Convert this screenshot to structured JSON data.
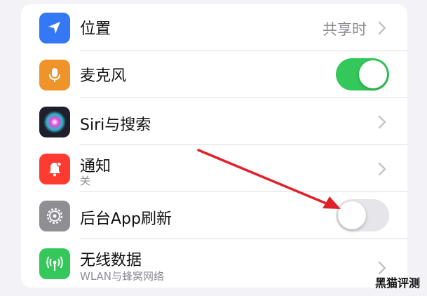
{
  "rows": [
    {
      "title": "位置",
      "value": "共享时",
      "icon": "location-arrow-icon",
      "color": "#3478f6"
    },
    {
      "title": "麦克风",
      "toggle_on": true,
      "icon": "microphone-icon",
      "color": "#f0932b"
    },
    {
      "title": "Siri与搜索",
      "icon": "siri-icon",
      "color": "#2b2b3a"
    },
    {
      "title": "通知",
      "subtitle": "关",
      "icon": "bell-icon",
      "color": "#ff3b30"
    },
    {
      "title": "后台App刷新",
      "toggle_on": false,
      "icon": "gear-icon",
      "color": "#8e8e93"
    },
    {
      "title": "无线数据",
      "subtitle": "WLAN与蜂窝网络",
      "icon": "antenna-icon",
      "color": "#34c759"
    }
  ],
  "colors": {
    "toggle_on": "#34c759",
    "toggle_off": "#e5e5ea",
    "annotation_arrow": "#e0212b"
  },
  "watermark": "黑猫评测"
}
